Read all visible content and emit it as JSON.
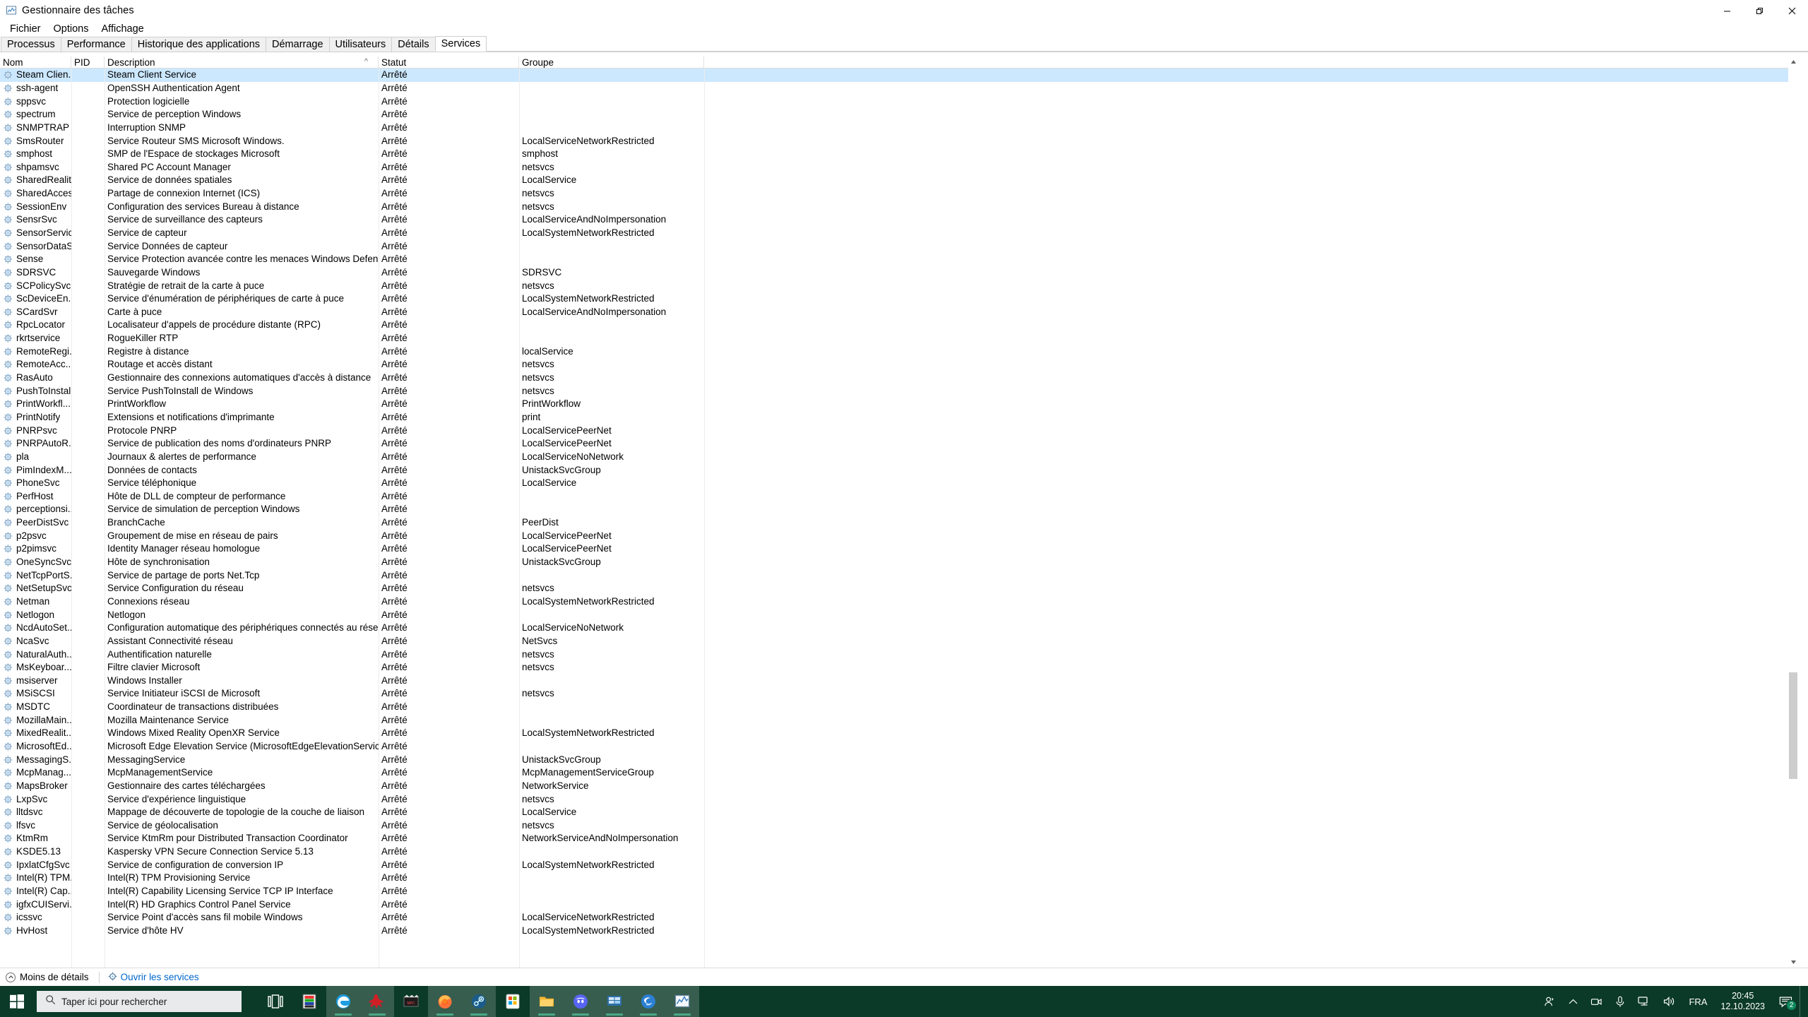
{
  "window": {
    "title": "Gestionnaire des tâches",
    "app_icon": "task-manager-icon",
    "minimize_glyph": "—",
    "maximize_glyph": "❐",
    "close_glyph": "✕"
  },
  "menu": {
    "items": [
      {
        "label": "Fichier"
      },
      {
        "label": "Options"
      },
      {
        "label": "Affichage"
      }
    ]
  },
  "tabs": {
    "items": [
      {
        "label": "Processus",
        "active": false
      },
      {
        "label": "Performance",
        "active": false
      },
      {
        "label": "Historique des applications",
        "active": false
      },
      {
        "label": "Démarrage",
        "active": false
      },
      {
        "label": "Utilisateurs",
        "active": false
      },
      {
        "label": "Détails",
        "active": false
      },
      {
        "label": "Services",
        "active": true
      }
    ]
  },
  "table": {
    "columns": [
      {
        "key": "name",
        "label": "Nom"
      },
      {
        "key": "pid",
        "label": "PID"
      },
      {
        "key": "description",
        "label": "Description"
      },
      {
        "key": "status",
        "label": "Statut"
      },
      {
        "key": "group",
        "label": "Groupe"
      }
    ],
    "sort_indicator": "^",
    "rows": [
      {
        "name": "Steam Clien...",
        "pid": "",
        "description": "Steam Client Service",
        "status": "Arrêté",
        "group": "",
        "selected": true
      },
      {
        "name": "ssh-agent",
        "pid": "",
        "description": "OpenSSH Authentication Agent",
        "status": "Arrêté",
        "group": ""
      },
      {
        "name": "sppsvc",
        "pid": "",
        "description": "Protection logicielle",
        "status": "Arrêté",
        "group": ""
      },
      {
        "name": "spectrum",
        "pid": "",
        "description": "Service de perception Windows",
        "status": "Arrêté",
        "group": ""
      },
      {
        "name": "SNMPTRAP",
        "pid": "",
        "description": "Interruption SNMP",
        "status": "Arrêté",
        "group": ""
      },
      {
        "name": "SmsRouter",
        "pid": "",
        "description": "Service Routeur SMS Microsoft Windows.",
        "status": "Arrêté",
        "group": "LocalServiceNetworkRestricted"
      },
      {
        "name": "smphost",
        "pid": "",
        "description": "SMP de l'Espace de stockages Microsoft",
        "status": "Arrêté",
        "group": "smphost"
      },
      {
        "name": "shpamsvc",
        "pid": "",
        "description": "Shared PC Account Manager",
        "status": "Arrêté",
        "group": "netsvcs"
      },
      {
        "name": "SharedRealit...",
        "pid": "",
        "description": "Service de données spatiales",
        "status": "Arrêté",
        "group": "LocalService"
      },
      {
        "name": "SharedAccess",
        "pid": "",
        "description": "Partage de connexion Internet (ICS)",
        "status": "Arrêté",
        "group": "netsvcs"
      },
      {
        "name": "SessionEnv",
        "pid": "",
        "description": "Configuration des services Bureau à distance",
        "status": "Arrêté",
        "group": "netsvcs"
      },
      {
        "name": "SensrSvc",
        "pid": "",
        "description": "Service de surveillance des capteurs",
        "status": "Arrêté",
        "group": "LocalServiceAndNoImpersonation"
      },
      {
        "name": "SensorService",
        "pid": "",
        "description": "Service de capteur",
        "status": "Arrêté",
        "group": "LocalSystemNetworkRestricted"
      },
      {
        "name": "SensorDataS...",
        "pid": "",
        "description": "Service Données de capteur",
        "status": "Arrêté",
        "group": ""
      },
      {
        "name": "Sense",
        "pid": "",
        "description": "Service Protection avancée contre les menaces Windows Defender",
        "status": "Arrêté",
        "group": ""
      },
      {
        "name": "SDRSVC",
        "pid": "",
        "description": "Sauvegarde Windows",
        "status": "Arrêté",
        "group": "SDRSVC"
      },
      {
        "name": "SCPolicySvc",
        "pid": "",
        "description": "Stratégie de retrait de la carte à puce",
        "status": "Arrêté",
        "group": "netsvcs"
      },
      {
        "name": "ScDeviceEn...",
        "pid": "",
        "description": "Service d'énumération de périphériques de carte à puce",
        "status": "Arrêté",
        "group": "LocalSystemNetworkRestricted"
      },
      {
        "name": "SCardSvr",
        "pid": "",
        "description": "Carte à puce",
        "status": "Arrêté",
        "group": "LocalServiceAndNoImpersonation"
      },
      {
        "name": "RpcLocator",
        "pid": "",
        "description": "Localisateur d'appels de procédure distante (RPC)",
        "status": "Arrêté",
        "group": ""
      },
      {
        "name": "rkrtservice",
        "pid": "",
        "description": "RogueKiller RTP",
        "status": "Arrêté",
        "group": ""
      },
      {
        "name": "RemoteRegi...",
        "pid": "",
        "description": "Registre à distance",
        "status": "Arrêté",
        "group": "localService"
      },
      {
        "name": "RemoteAcc...",
        "pid": "",
        "description": "Routage et accès distant",
        "status": "Arrêté",
        "group": "netsvcs"
      },
      {
        "name": "RasAuto",
        "pid": "",
        "description": "Gestionnaire des connexions automatiques d'accès à distance",
        "status": "Arrêté",
        "group": "netsvcs"
      },
      {
        "name": "PushToInstall",
        "pid": "",
        "description": "Service PushToInstall de Windows",
        "status": "Arrêté",
        "group": "netsvcs"
      },
      {
        "name": "PrintWorkfl...",
        "pid": "",
        "description": "PrintWorkflow",
        "status": "Arrêté",
        "group": "PrintWorkflow"
      },
      {
        "name": "PrintNotify",
        "pid": "",
        "description": "Extensions et notifications d'imprimante",
        "status": "Arrêté",
        "group": "print"
      },
      {
        "name": "PNRPsvc",
        "pid": "",
        "description": "Protocole PNRP",
        "status": "Arrêté",
        "group": "LocalServicePeerNet"
      },
      {
        "name": "PNRPAutoR...",
        "pid": "",
        "description": "Service de publication des noms d'ordinateurs PNRP",
        "status": "Arrêté",
        "group": "LocalServicePeerNet"
      },
      {
        "name": "pla",
        "pid": "",
        "description": "Journaux & alertes de performance",
        "status": "Arrêté",
        "group": "LocalServiceNoNetwork"
      },
      {
        "name": "PimIndexM...",
        "pid": "",
        "description": "Données de contacts",
        "status": "Arrêté",
        "group": "UnistackSvcGroup"
      },
      {
        "name": "PhoneSvc",
        "pid": "",
        "description": "Service téléphonique",
        "status": "Arrêté",
        "group": "LocalService"
      },
      {
        "name": "PerfHost",
        "pid": "",
        "description": "Hôte de DLL de compteur de performance",
        "status": "Arrêté",
        "group": ""
      },
      {
        "name": "perceptionsi...",
        "pid": "",
        "description": "Service de simulation de perception Windows",
        "status": "Arrêté",
        "group": ""
      },
      {
        "name": "PeerDistSvc",
        "pid": "",
        "description": "BranchCache",
        "status": "Arrêté",
        "group": "PeerDist"
      },
      {
        "name": "p2psvc",
        "pid": "",
        "description": "Groupement de mise en réseau de pairs",
        "status": "Arrêté",
        "group": "LocalServicePeerNet"
      },
      {
        "name": "p2pimsvc",
        "pid": "",
        "description": "Identity Manager réseau homologue",
        "status": "Arrêté",
        "group": "LocalServicePeerNet"
      },
      {
        "name": "OneSyncSvc",
        "pid": "",
        "description": "Hôte de synchronisation",
        "status": "Arrêté",
        "group": "UnistackSvcGroup"
      },
      {
        "name": "NetTcpPortS...",
        "pid": "",
        "description": "Service de partage de ports Net.Tcp",
        "status": "Arrêté",
        "group": ""
      },
      {
        "name": "NetSetupSvc",
        "pid": "",
        "description": "Service Configuration du réseau",
        "status": "Arrêté",
        "group": "netsvcs"
      },
      {
        "name": "Netman",
        "pid": "",
        "description": "Connexions réseau",
        "status": "Arrêté",
        "group": "LocalSystemNetworkRestricted"
      },
      {
        "name": "Netlogon",
        "pid": "",
        "description": "Netlogon",
        "status": "Arrêté",
        "group": ""
      },
      {
        "name": "NcdAutoSet...",
        "pid": "",
        "description": "Configuration automatique des périphériques connectés au réseau",
        "status": "Arrêté",
        "group": "LocalServiceNoNetwork"
      },
      {
        "name": "NcaSvc",
        "pid": "",
        "description": "Assistant Connectivité réseau",
        "status": "Arrêté",
        "group": "NetSvcs"
      },
      {
        "name": "NaturalAuth...",
        "pid": "",
        "description": "Authentification naturelle",
        "status": "Arrêté",
        "group": "netsvcs"
      },
      {
        "name": "MsKeyboar...",
        "pid": "",
        "description": "Filtre clavier Microsoft",
        "status": "Arrêté",
        "group": "netsvcs"
      },
      {
        "name": "msiserver",
        "pid": "",
        "description": "Windows Installer",
        "status": "Arrêté",
        "group": ""
      },
      {
        "name": "MSiSCSI",
        "pid": "",
        "description": "Service Initiateur iSCSI de Microsoft",
        "status": "Arrêté",
        "group": "netsvcs"
      },
      {
        "name": "MSDTC",
        "pid": "",
        "description": "Coordinateur de transactions distribuées",
        "status": "Arrêté",
        "group": ""
      },
      {
        "name": "MozillaMain...",
        "pid": "",
        "description": "Mozilla Maintenance Service",
        "status": "Arrêté",
        "group": ""
      },
      {
        "name": "MixedRealit...",
        "pid": "",
        "description": "Windows Mixed Reality OpenXR Service",
        "status": "Arrêté",
        "group": "LocalSystemNetworkRestricted"
      },
      {
        "name": "MicrosoftEd...",
        "pid": "",
        "description": "Microsoft Edge Elevation Service (MicrosoftEdgeElevationService)",
        "status": "Arrêté",
        "group": ""
      },
      {
        "name": "MessagingS...",
        "pid": "",
        "description": "MessagingService",
        "status": "Arrêté",
        "group": "UnistackSvcGroup"
      },
      {
        "name": "McpManag...",
        "pid": "",
        "description": "McpManagementService",
        "status": "Arrêté",
        "group": "McpManagementServiceGroup"
      },
      {
        "name": "MapsBroker",
        "pid": "",
        "description": "Gestionnaire des cartes téléchargées",
        "status": "Arrêté",
        "group": "NetworkService"
      },
      {
        "name": "LxpSvc",
        "pid": "",
        "description": "Service d'expérience linguistique",
        "status": "Arrêté",
        "group": "netsvcs"
      },
      {
        "name": "lltdsvc",
        "pid": "",
        "description": "Mappage de découverte de topologie de la couche de liaison",
        "status": "Arrêté",
        "group": "LocalService"
      },
      {
        "name": "lfsvc",
        "pid": "",
        "description": "Service de géolocalisation",
        "status": "Arrêté",
        "group": "netsvcs"
      },
      {
        "name": "KtmRm",
        "pid": "",
        "description": "Service KtmRm pour Distributed Transaction Coordinator",
        "status": "Arrêté",
        "group": "NetworkServiceAndNoImpersonation"
      },
      {
        "name": "KSDE5.13",
        "pid": "",
        "description": "Kaspersky VPN Secure Connection Service 5.13",
        "status": "Arrêté",
        "group": ""
      },
      {
        "name": "IpxlatCfgSvc",
        "pid": "",
        "description": "Service de configuration de conversion IP",
        "status": "Arrêté",
        "group": "LocalSystemNetworkRestricted"
      },
      {
        "name": "Intel(R) TPM...",
        "pid": "",
        "description": "Intel(R) TPM Provisioning Service",
        "status": "Arrêté",
        "group": ""
      },
      {
        "name": "Intel(R) Cap...",
        "pid": "",
        "description": "Intel(R) Capability Licensing Service TCP IP Interface",
        "status": "Arrêté",
        "group": ""
      },
      {
        "name": "igfxCUIServi...",
        "pid": "",
        "description": "Intel(R) HD Graphics Control Panel Service",
        "status": "Arrêté",
        "group": ""
      },
      {
        "name": "icssvc",
        "pid": "",
        "description": "Service Point d'accès sans fil mobile Windows",
        "status": "Arrêté",
        "group": "LocalServiceNetworkRestricted"
      },
      {
        "name": "HvHost",
        "pid": "",
        "description": "Service d'hôte HV",
        "status": "Arrêté",
        "group": "LocalSystemNetworkRestricted"
      }
    ]
  },
  "status_bar": {
    "less_details_label": "Moins de détails",
    "open_services_label": "Ouvrir les services"
  },
  "taskbar": {
    "start_label": "start-button",
    "search_placeholder": "Taper ici pour rechercher",
    "apps": [
      {
        "name": "task-view-icon",
        "active": false
      },
      {
        "name": "color-panel-icon",
        "active": false
      },
      {
        "name": "microsoft-edge-icon",
        "active": true
      },
      {
        "name": "hitman-app-icon",
        "active": true
      },
      {
        "name": "media-player-classic-icon",
        "active": false
      },
      {
        "name": "firefox-icon",
        "active": true
      },
      {
        "name": "steam-icon",
        "active": true
      },
      {
        "name": "microsoft-store-icon",
        "active": false
      },
      {
        "name": "file-explorer-icon",
        "active": true
      },
      {
        "name": "discord-icon",
        "active": true
      },
      {
        "name": "remote-desktop-icon",
        "active": true
      },
      {
        "name": "edge-dev-icon",
        "active": true
      },
      {
        "name": "task-manager-icon",
        "active": true
      }
    ],
    "tray": {
      "people_icon": "people-icon",
      "show_hidden_icon": "chevron-up-icon",
      "camera_icon": "camera-icon",
      "microphone_icon": "microphone-icon",
      "network_icon": "network-icon",
      "volume_icon": "volume-icon",
      "language": "FRA",
      "time": "20:45",
      "date": "12.10.2023",
      "notification_count": "2"
    }
  },
  "colors": {
    "selection": "#cce8ff",
    "link": "#0066cc",
    "taskbar": "#0b3a28",
    "taskbar_accent": "#4aa888"
  }
}
